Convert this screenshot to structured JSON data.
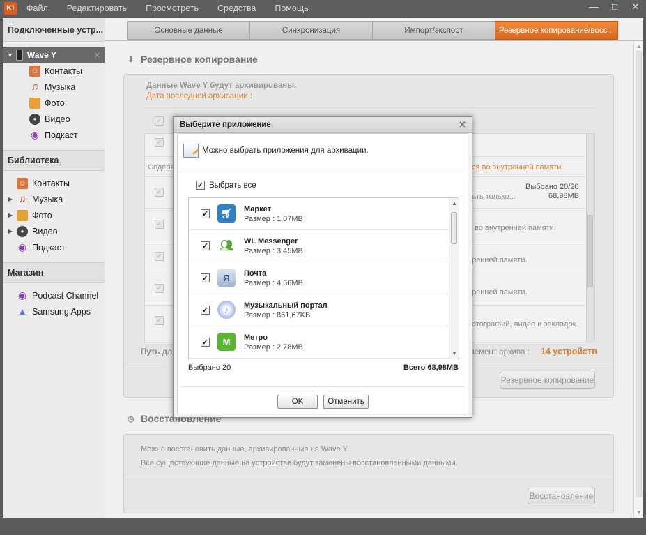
{
  "menu": {
    "logo": "K!",
    "items": [
      "Файл",
      "Редактировать",
      "Просмотреть",
      "Средства",
      "Помощь"
    ]
  },
  "sidebar": {
    "connected_header": "Подключенные устр...",
    "device_name": "Wave Y",
    "device_items": [
      "Контакты",
      "Музыка",
      "Фото",
      "Видео",
      "Подкаст"
    ],
    "library_header": "Библиотека",
    "library_items": [
      "Контакты",
      "Музыка",
      "Фото",
      "Видео",
      "Подкаст"
    ],
    "store_header": "Магазин",
    "store_items": [
      "Podcast Channel",
      "Samsung Apps"
    ]
  },
  "tabs": [
    "Основные данные",
    "Синхронизация",
    "Импорт/экспорт",
    "Резервное копирование/восс..."
  ],
  "backup": {
    "title": "Резервное копирование",
    "info_bold": "Данные Wave Y  будут архивированы.",
    "info_orange": "Дата последней архивации :",
    "content_label": "Содерж",
    "warn_orange": "ся во внутренней памяти.",
    "selected_summary": "Выбрано 20/20",
    "selected_size": "68,98MB",
    "row_texts": [
      "ать только...",
      "во внутренней памяти.",
      "ренней памяти.",
      "ренней памяти.",
      "отографий, видео и закладок."
    ],
    "path_label": "Путь дл",
    "archive_label": "лемент архива :",
    "archive_count": "14 устройств",
    "backup_button": "Резервное копирование"
  },
  "restore": {
    "title": "Восстановление",
    "line1": "Можно восстановить данные, архивированные на Wave Y .",
    "line2": "Все существующие данные на устройстве будут заменены восстановленными данными.",
    "restore_button": "Восстановление"
  },
  "dialog": {
    "title": "Выберите приложение",
    "description": "Можно выбрать приложения для архивации.",
    "select_all": "Выбрать все",
    "apps": [
      {
        "name": "Маркет",
        "size": "Размер : 1,07MB",
        "icon": "market-icon",
        "color": "#2f7fc9"
      },
      {
        "name": "WL Messenger",
        "size": "Размер : 3,45MB",
        "icon": "messenger-icon",
        "color": "#5aa03c"
      },
      {
        "name": "Почта",
        "size": "Размер : 4,66MB",
        "icon": "mail-icon",
        "color": "#8fa8c8"
      },
      {
        "name": "Музыкальный портал",
        "size": "Размер : 861,67KB",
        "icon": "music-portal-icon",
        "color": "#7b8fd6"
      },
      {
        "name": "Метро",
        "size": "Размер : 2,78MB",
        "icon": "metro-icon",
        "color": "#58b82f"
      }
    ],
    "selected_count": "Выбрано 20",
    "total_size": "Всего 68,98MB",
    "ok_button": "OK",
    "cancel_button": "Отменить"
  },
  "colors": {
    "accent": "#e07020",
    "orange_text": "#d9822b"
  }
}
